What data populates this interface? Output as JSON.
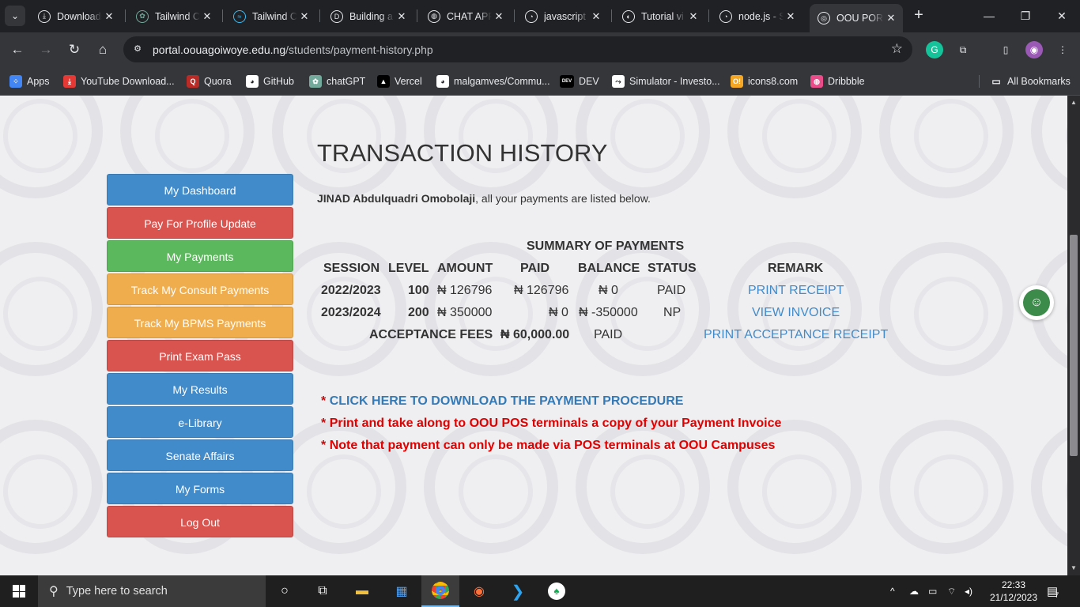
{
  "browser": {
    "tabs": [
      {
        "title": "Downloads",
        "icon": "download-icon",
        "color": "#e8eaed"
      },
      {
        "title": "Tailwind CSS",
        "icon": "chatgpt-icon",
        "color": "#74aa9c"
      },
      {
        "title": "Tailwind CSS",
        "icon": "tailwind-icon",
        "color": "#38bdf8"
      },
      {
        "title": "Building a",
        "icon": "dev-icon",
        "color": "#e8eaed"
      },
      {
        "title": "CHAT APP",
        "icon": "globe-icon",
        "color": "#e8eaed"
      },
      {
        "title": "javascript",
        "icon": "search-result-icon",
        "color": "#e8eaed"
      },
      {
        "title": "Tutorial vi",
        "icon": "tutorial-icon",
        "color": "#e8eaed"
      },
      {
        "title": "node.js - S",
        "icon": "search-result-icon",
        "color": "#e8eaed"
      },
      {
        "title": "OOU POR",
        "icon": "oou-logo-icon",
        "color": "#e8eaed"
      }
    ],
    "url_host": "portal.oouagoiwoye.edu.ng",
    "url_path": "/students/payment-history.php",
    "bookmarks": [
      {
        "label": "Apps",
        "icon": "apps-grid-icon",
        "color": "#4285f4"
      },
      {
        "label": "YouTube Download...",
        "icon": "youtube-download-icon",
        "color": "#e53935"
      },
      {
        "label": "Quora",
        "icon": "quora-icon",
        "color": "#b92b27"
      },
      {
        "label": "GitHub",
        "icon": "github-icon",
        "color": "#ffffff"
      },
      {
        "label": "chatGPT",
        "icon": "chatgpt-icon",
        "color": "#74aa9c"
      },
      {
        "label": "Vercel",
        "icon": "vercel-icon",
        "color": "#000000"
      },
      {
        "label": "malgamves/Commu...",
        "icon": "github-icon",
        "color": "#ffffff"
      },
      {
        "label": "DEV",
        "icon": "dev-icon",
        "color": "#000000"
      },
      {
        "label": "Simulator - Investo...",
        "icon": "simulator-icon",
        "color": "#ffffff"
      },
      {
        "label": "icons8.com",
        "icon": "icons8-icon",
        "color": "#f5a623"
      },
      {
        "label": "Dribbble",
        "icon": "dribbble-icon",
        "color": "#ea4c89"
      }
    ],
    "all_bookmarks": "All Bookmarks"
  },
  "sidebar": {
    "items": [
      {
        "label": "My Dashboard",
        "color": "#428bca"
      },
      {
        "label": "Pay For Profile Update",
        "color": "#d9534f"
      },
      {
        "label": "My Payments",
        "color": "#5cb85c"
      },
      {
        "label": "Track My Consult Payments",
        "color": "#f0ad4e"
      },
      {
        "label": "Track My BPMS Payments",
        "color": "#f0ad4e"
      },
      {
        "label": "Print Exam Pass",
        "color": "#d9534f"
      },
      {
        "label": "My Results",
        "color": "#428bca"
      },
      {
        "label": "e-Library",
        "color": "#428bca"
      },
      {
        "label": "Senate Affairs",
        "color": "#428bca"
      },
      {
        "label": "My Forms",
        "color": "#428bca"
      },
      {
        "label": "Log Out",
        "color": "#d9534f"
      }
    ]
  },
  "main": {
    "heading": "TRANSACTION HISTORY",
    "student_name": "JINAD Abdulquadri Omobolaji",
    "intro_suffix": ", all your payments are listed below.",
    "summary_title": "SUMMARY OF PAYMENTS",
    "columns": [
      "SESSION",
      "LEVEL",
      "AMOUNT",
      "PAID",
      "BALANCE",
      "STATUS",
      "REMARK"
    ],
    "rows": [
      {
        "session": "2022/2023",
        "level": "100",
        "amount": "₦ 126796",
        "paid": "₦ 126796",
        "balance": "₦ 0",
        "status": "PAID",
        "remark": "PRINT RECEIPT"
      },
      {
        "session": "2023/2024",
        "level": "200",
        "amount": "₦ 350000",
        "paid": "₦ 0",
        "balance": "₦ -350000",
        "status": "NP",
        "remark": "VIEW INVOICE"
      }
    ],
    "acceptance": {
      "label": "ACCEPTANCE FEES",
      "amount": "₦ 60,000.00",
      "status": "PAID",
      "remark": "PRINT ACCEPTANCE RECEIPT"
    },
    "notes": {
      "star": "*",
      "download_link": "CLICK HERE TO DOWNLOAD THE PAYMENT PROCEDURE",
      "print_note": "Print and take along to OOU POS terminals a copy of your Payment Invoice",
      "pos_note": "Note that payment can only be made via POS terminals at OOU Campuses"
    }
  },
  "taskbar": {
    "search_placeholder": "Type here to search",
    "time": "22:33",
    "date": "21/12/2023",
    "notification_count": "7"
  }
}
